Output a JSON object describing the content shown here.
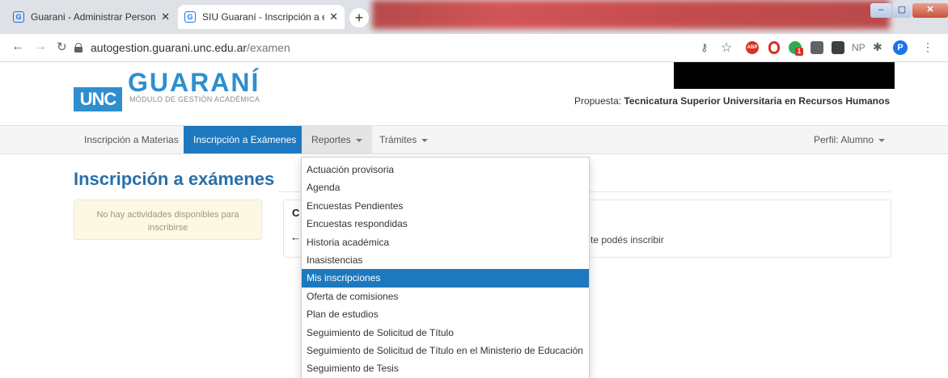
{
  "browser": {
    "tabs": [
      {
        "title": "Guarani - Administrar Personas",
        "active": false
      },
      {
        "title": "SIU Guaraní - Inscripción a exám",
        "active": true
      }
    ],
    "new_tab_label": "+",
    "url_host": "autogestion.guarani.unc.edu.ar",
    "url_path": "/examen",
    "window_controls": {
      "minimize": "–",
      "maximize": "▢",
      "close": "✕"
    },
    "toolbar_icons": [
      "key-icon",
      "star-icon",
      "adblock-icon",
      "opera-icon",
      "extension-badge-icon",
      "extension-icon",
      "extension-icon",
      "np-icon",
      "puzzle-icon",
      "profile-avatar",
      "menu-icon"
    ],
    "np_label": "NP",
    "profile_initial": "P",
    "ext_badge_count": "1"
  },
  "header": {
    "logo_unc": "UNC",
    "logo_guarani": "GUARANÍ",
    "logo_subtitle": "MÓDULO DE GESTIÓN ACADÉMICA",
    "propuesta_label": "Propuesta:",
    "propuesta_value": "Tecnicatura Superior Universitaria en Recursos Humanos"
  },
  "nav": {
    "items": [
      {
        "label": "Inscripción a Materias",
        "state": "normal"
      },
      {
        "label": "Inscripción a Exámenes",
        "state": "active"
      },
      {
        "label": "Reportes",
        "state": "open"
      },
      {
        "label": "Trámites",
        "state": "normal"
      }
    ],
    "profile": "Perfil: Alumno"
  },
  "main": {
    "heading": "Inscripción a exámenes",
    "alert": "No hay actividades disponibles para inscribirse",
    "panel_title": "C",
    "panel_arrow": "←",
    "panel_text": "te podés inscribir"
  },
  "dropdown": {
    "items": [
      "Actuación provisoria",
      "Agenda",
      "Encuestas Pendientes",
      "Encuestas respondidas",
      "Historia académica",
      "Inasistencias",
      "Mis inscripciones",
      "Oferta de comisiones",
      "Plan de estudios",
      "Seguimiento de Solicitud de Título",
      "Seguimiento de Solicitud de Título en el Ministerio de Educación",
      "Seguimiento de Tesis"
    ],
    "selected": "Mis inscripciones"
  },
  "colors": {
    "primary": "#1d79be",
    "logo_blue": "#2f8ece",
    "heading_blue": "#2a6fa8",
    "alert_bg": "#fcf8e3"
  }
}
